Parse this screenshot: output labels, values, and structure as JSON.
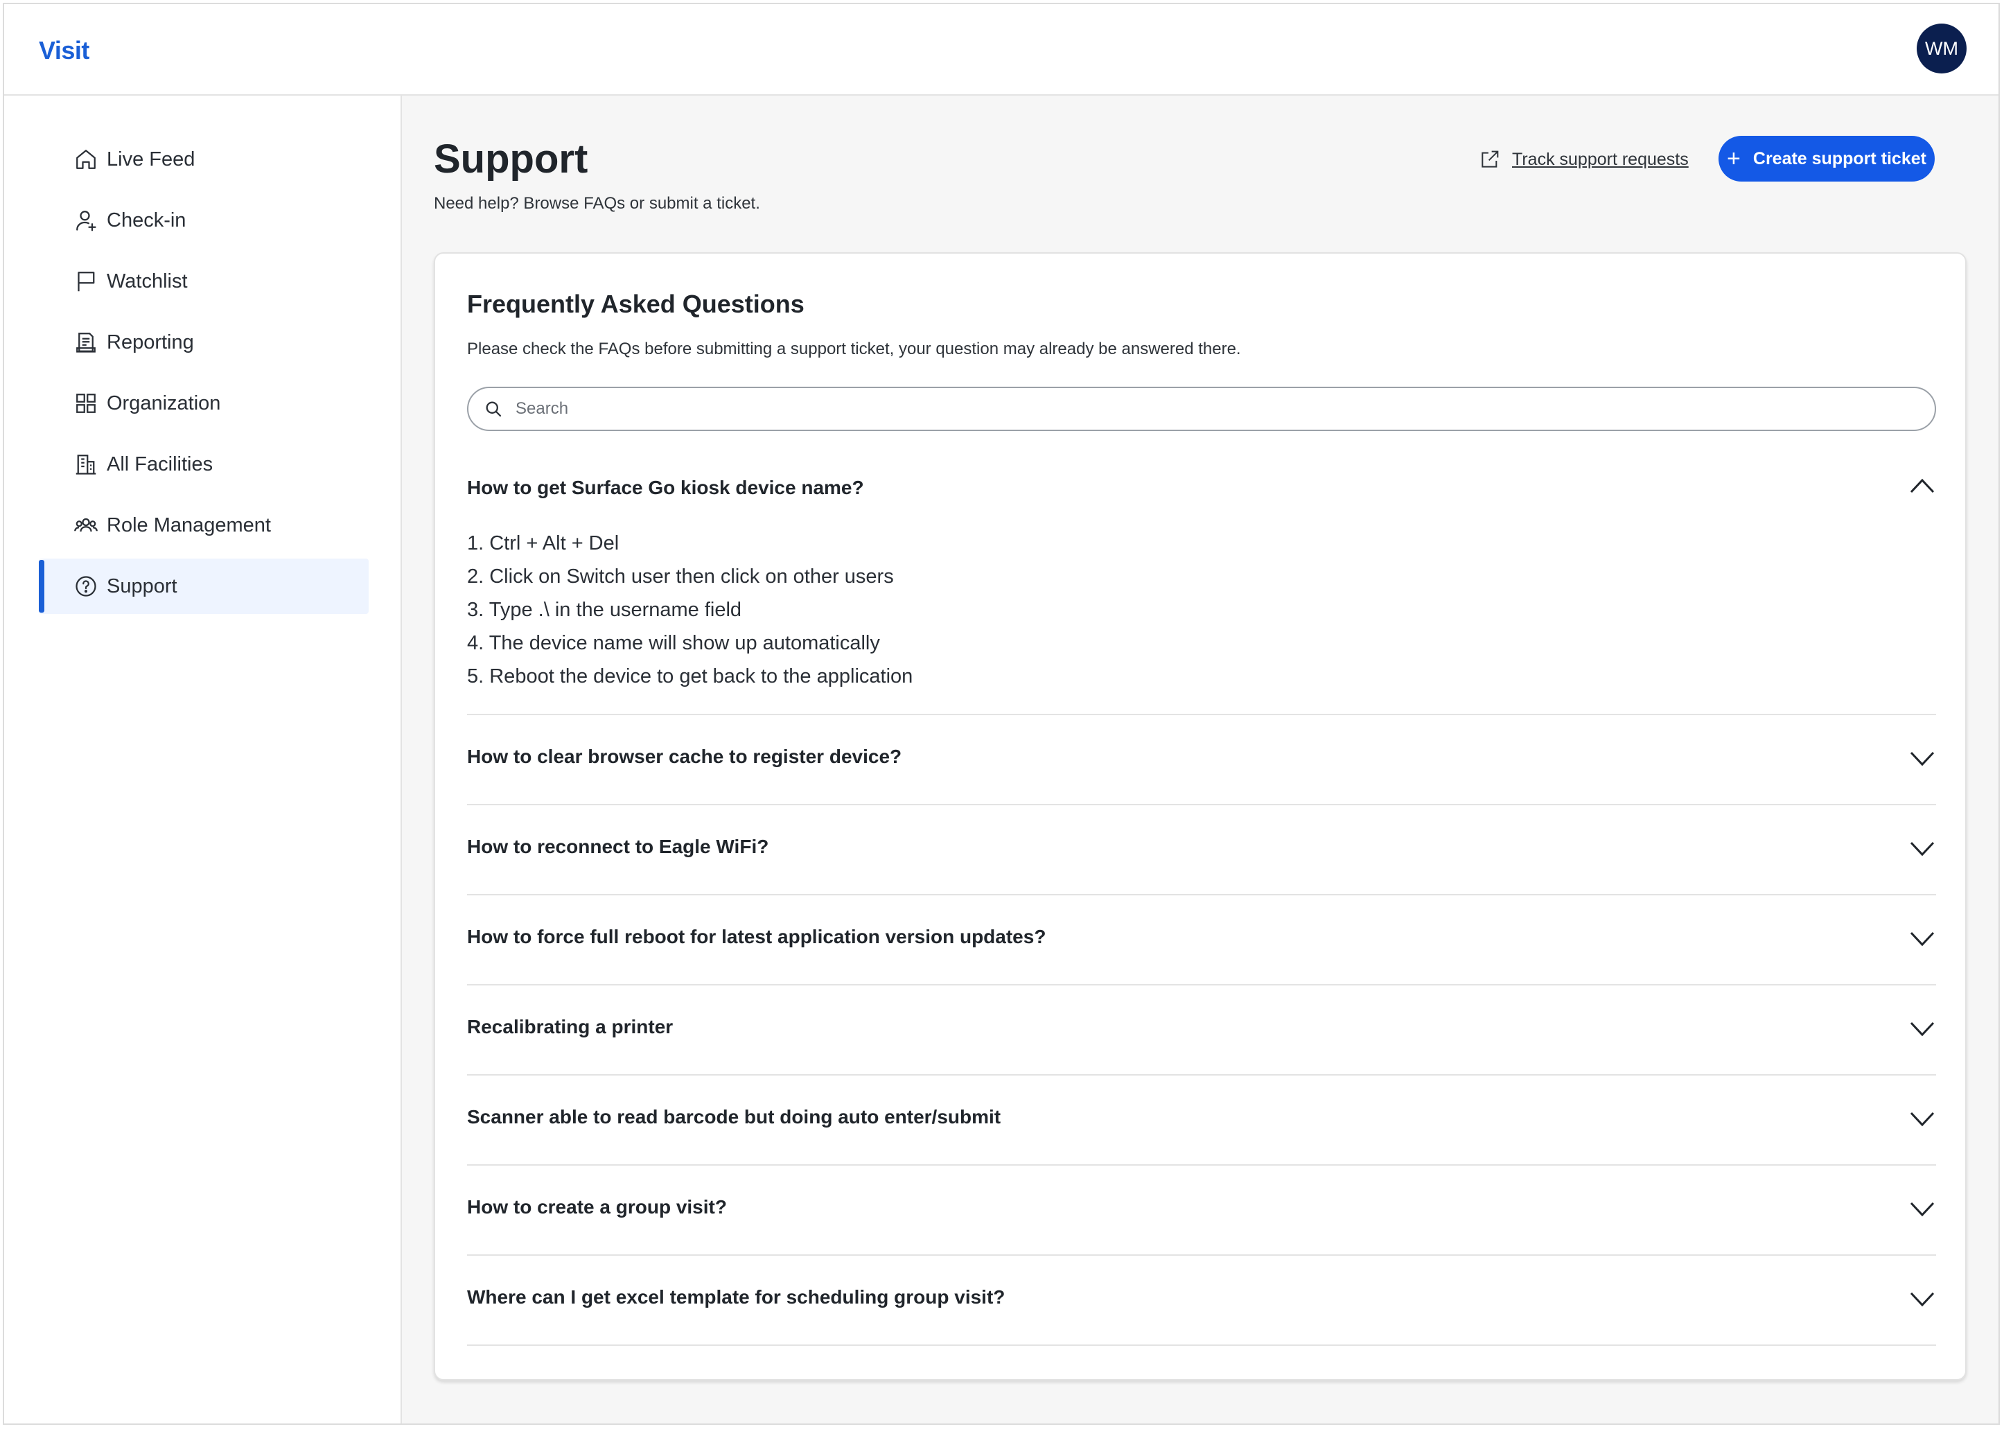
{
  "header": {
    "brand": "Visit",
    "avatar_initials": "WM"
  },
  "sidebar": {
    "items": [
      {
        "label": "Live Feed",
        "icon": "home-icon",
        "active": false
      },
      {
        "label": "Check-in",
        "icon": "person-add-icon",
        "active": false
      },
      {
        "label": "Watchlist",
        "icon": "flag-icon",
        "active": false
      },
      {
        "label": "Reporting",
        "icon": "report-icon",
        "active": false
      },
      {
        "label": "Organization",
        "icon": "grid-icon",
        "active": false
      },
      {
        "label": "All Facilities",
        "icon": "building-icon",
        "active": false
      },
      {
        "label": "Role Management",
        "icon": "people-group-icon",
        "active": false
      },
      {
        "label": "Support",
        "icon": "help-circle-icon",
        "active": true
      }
    ],
    "accent_color": "#1a5fd6"
  },
  "main": {
    "title": "Support",
    "subtitle": "Need help? Browse FAQs or submit a ticket.",
    "track_link": "Track support requests",
    "create_button": "Create support ticket",
    "button_color": "#1459e6"
  },
  "faq": {
    "title": "Frequently Asked Questions",
    "description": "Please check the FAQs before submitting a support ticket, your question may already be answered there.",
    "search_placeholder": "Search",
    "items": [
      {
        "question": "How to get Surface Go kiosk device name?",
        "expanded": true,
        "answer": [
          "1. Ctrl + Alt + Del",
          "2. Click on Switch user then click on other users",
          "3. Type .\\ in the username field",
          "4. The device name will show up automatically",
          "5. Reboot the device to get back to the application"
        ]
      },
      {
        "question": "How to clear browser cache to register device?",
        "expanded": false
      },
      {
        "question": "How to reconnect to Eagle WiFi?",
        "expanded": false
      },
      {
        "question": "How to force full reboot for latest application version updates?",
        "expanded": false
      },
      {
        "question": "Recalibrating a printer",
        "expanded": false
      },
      {
        "question": "Scanner able to read barcode but doing auto enter/submit",
        "expanded": false
      },
      {
        "question": "How to create a group visit?",
        "expanded": false
      },
      {
        "question": "Where can I get excel template for scheduling group visit?",
        "expanded": false
      }
    ]
  }
}
